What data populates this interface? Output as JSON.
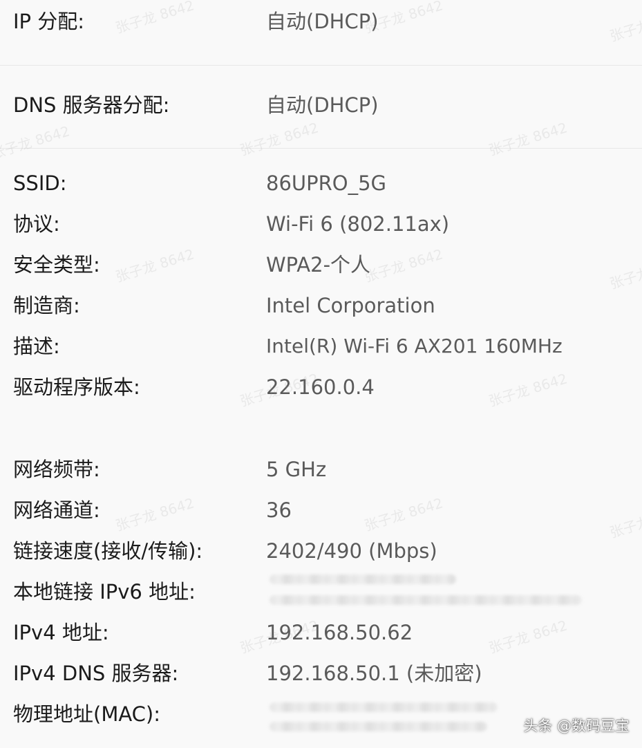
{
  "assignment": {
    "ip_label": "IP 分配:",
    "ip_value": "自动(DHCP)",
    "dns_label": "DNS 服务器分配:",
    "dns_value": "自动(DHCP)"
  },
  "details": [
    {
      "label": "SSID:",
      "value": "86UPRO_5G"
    },
    {
      "label": "协议:",
      "value": "Wi-Fi 6 (802.11ax)"
    },
    {
      "label": "安全类型:",
      "value": "WPA2-个人"
    },
    {
      "label": "制造商:",
      "value": "Intel Corporation"
    },
    {
      "label": "描述:",
      "value": "Intel(R) Wi-Fi 6 AX201 160MHz"
    },
    {
      "label": "驱动程序版本:",
      "value": "22.160.0.4"
    },
    {
      "label": "网络频带:",
      "value": "5 GHz"
    },
    {
      "label": "网络通道:",
      "value": "36"
    },
    {
      "label": "链接速度(接收/传输):",
      "value": "2402/490 (Mbps)"
    },
    {
      "label": "本地链接 IPv6 地址:",
      "value": ""
    },
    {
      "label": "IPv4 地址:",
      "value": "192.168.50.62"
    },
    {
      "label": "IPv4 DNS 服务器:",
      "value": "192.168.50.1 (未加密)"
    },
    {
      "label": "物理地址(MAC):",
      "value": ""
    }
  ],
  "watermark": "张子龙 8642",
  "source_mark": "头条 @数码豆宝"
}
